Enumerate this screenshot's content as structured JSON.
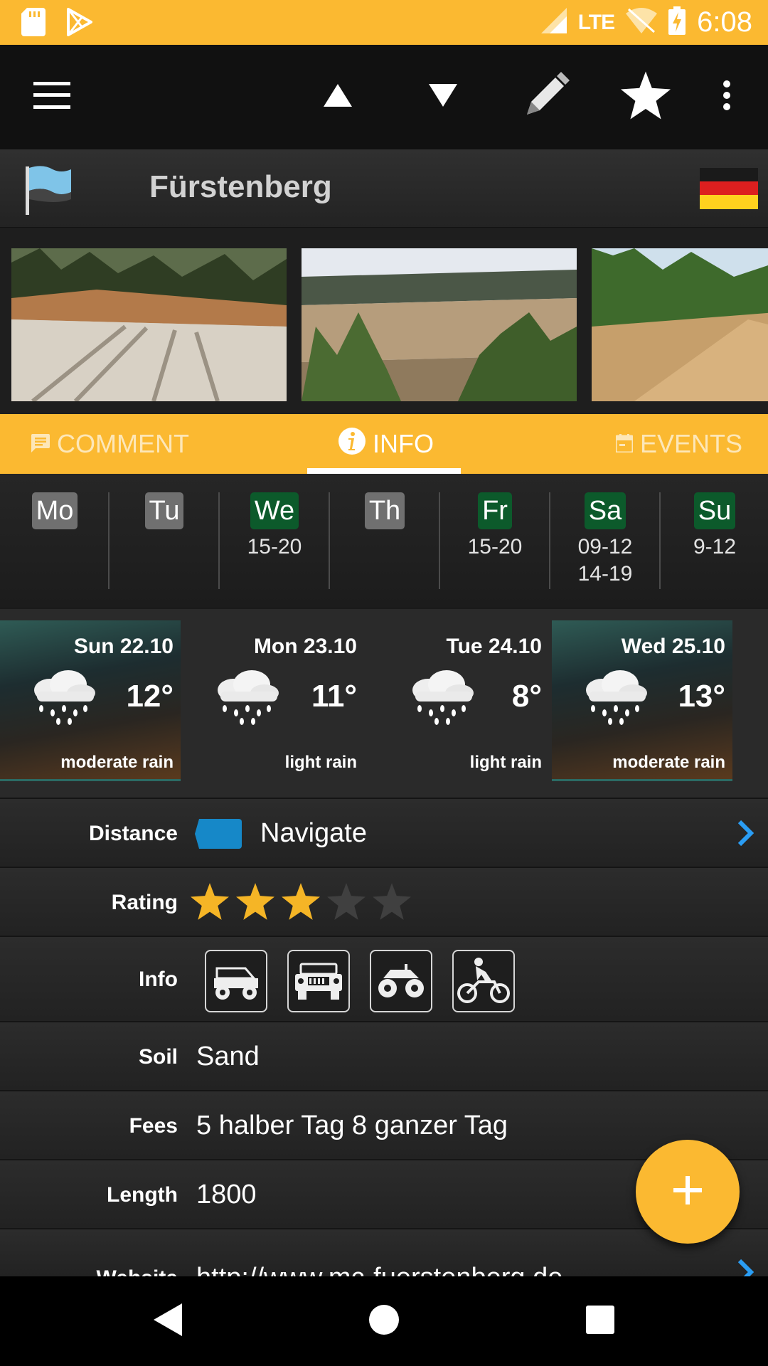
{
  "status_bar": {
    "time": "6:08",
    "network": "LTE",
    "background": "#fbb931",
    "icons": [
      "sd-card-icon",
      "play-store-icon",
      "signal-icon",
      "wifi-off-icon",
      "battery-charging-icon"
    ]
  },
  "toolbar": {
    "icons": [
      "menu-icon",
      "arrow-up-icon",
      "arrow-down-icon",
      "edit-pencil-icon",
      "star-icon",
      "more-vert-icon"
    ]
  },
  "header": {
    "title": "Fürstenberg",
    "country_flag": "germany-flag-icon"
  },
  "gallery": {
    "photos": [
      "photo-sand-track",
      "photo-pine-dunes",
      "photo-forest-trail"
    ]
  },
  "tabs": {
    "items": [
      {
        "label": "COMMENT",
        "icon": "comment-icon",
        "active": false
      },
      {
        "label": "INFO",
        "icon": "info-icon",
        "active": true
      },
      {
        "label": "EVENTS",
        "icon": "calendar-icon",
        "active": false
      }
    ],
    "accent": "#fbb931"
  },
  "schedule": {
    "days": [
      {
        "day": "Mo",
        "hours": "",
        "open": false
      },
      {
        "day": "Tu",
        "hours": "",
        "open": false
      },
      {
        "day": "We",
        "hours": "15-20",
        "open": true
      },
      {
        "day": "Th",
        "hours": "",
        "open": false
      },
      {
        "day": "Fr",
        "hours": "15-20",
        "open": true
      },
      {
        "day": "Sa",
        "hours": "09-12\n14-19",
        "open": true
      },
      {
        "day": "Su",
        "hours": "9-12",
        "open": true
      }
    ],
    "open_color": "#0c5a2b",
    "closed_color": "#707070"
  },
  "weather": {
    "days": [
      {
        "date": "Sun 22.10",
        "temp": "12°",
        "desc": "moderate rain",
        "icon": "rain-cloud-icon"
      },
      {
        "date": "Mon 23.10",
        "temp": "11°",
        "desc": "light rain",
        "icon": "rain-cloud-icon"
      },
      {
        "date": "Tue 24.10",
        "temp": "8°",
        "desc": "light rain",
        "icon": "rain-cloud-icon"
      },
      {
        "date": "Wed 25.10",
        "temp": "13°",
        "desc": "moderate rain",
        "icon": "rain-cloud-icon"
      }
    ]
  },
  "details": {
    "distance": {
      "label": "Distance",
      "value": "Navigate"
    },
    "rating": {
      "label": "Rating",
      "stars": 3,
      "max": 5
    },
    "info": {
      "label": "Info",
      "icons": [
        "buggy-icon",
        "jeep-icon",
        "quad-icon",
        "motocross-icon"
      ]
    },
    "soil": {
      "label": "Soil",
      "value": "Sand"
    },
    "fees": {
      "label": "Fees",
      "value": "5 halber Tag 8 ganzer Tag"
    },
    "length": {
      "label": "Length",
      "value": "1800"
    },
    "website": {
      "label": "Website",
      "value": "http://www.mc-fuerstenberg.de"
    }
  },
  "fab": {
    "icon": "add-icon"
  },
  "nav_bar": {
    "icons": [
      "back-icon",
      "home-icon",
      "recents-icon"
    ]
  }
}
